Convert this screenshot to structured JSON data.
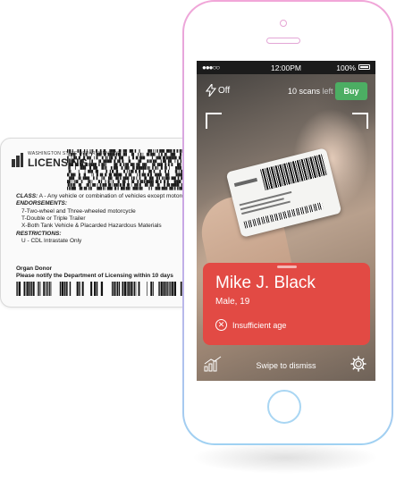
{
  "card": {
    "logo_top": "WASHINGTON STATE DEPARTMENT OF",
    "logo_main": "LICENSING",
    "class_label": "CLASS:",
    "class_text": " A - Any vehicle or combination of vehicles except motorcycles",
    "endorsements_label": "ENDORSEMENTS:",
    "endorsements": [
      "7-Two-wheel and Three-wheeled motorcycle",
      "T-Double or Triple Trailer",
      "X-Both Tank Vehicle & Placarded Hazardous Materials"
    ],
    "restrictions_label": "RESTRICTIONS:",
    "restrictions": [
      "U - CDL Intrastate Only"
    ],
    "donor": "Organ Donor",
    "notify": "Please notify the Department of Licensing within 10 days"
  },
  "phone": {
    "status": {
      "time": "12:00PM",
      "battery": "100%"
    },
    "toolbar": {
      "flash_label": "Off",
      "scans_count": "10 scans",
      "scans_left": "left",
      "buy_label": "Buy"
    },
    "result": {
      "name": "Mike J. Black",
      "gender_age": "Male, 19",
      "warning": "Insufficient age",
      "bg_color": "#e24a44"
    },
    "bottom": {
      "swipe_hint": "Swipe to dismiss"
    },
    "icons": {
      "flash": "flash-icon",
      "stats": "chart-icon",
      "settings": "gear-icon",
      "error": "x-circle-icon"
    }
  },
  "colors": {
    "buy_button": "#4cae63",
    "phone_gradient_top": "#f1a6d8",
    "phone_gradient_bottom": "#9fd1f2"
  }
}
